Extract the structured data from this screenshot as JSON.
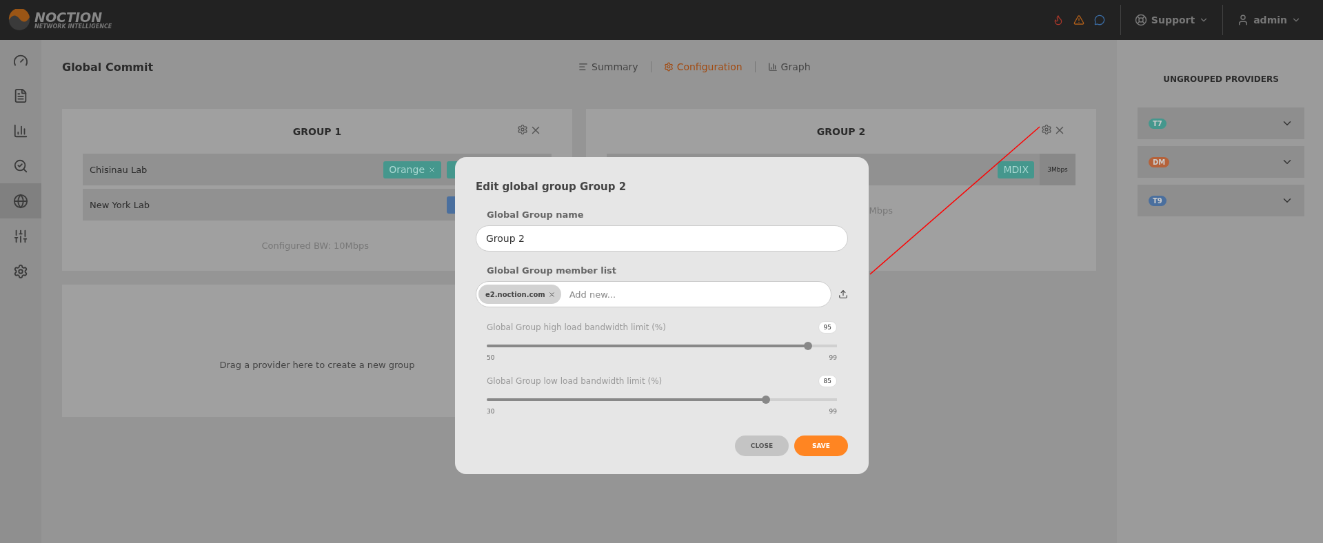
{
  "brand": {
    "name": "NOCTION",
    "tagline": "NETWORK INTELLIGENCE"
  },
  "topbar": {
    "support": "Support",
    "user": "admin"
  },
  "sidebar": {
    "items": [
      {
        "selected": false
      },
      {
        "selected": false
      },
      {
        "selected": false
      },
      {
        "selected": false
      },
      {
        "selected": true
      },
      {
        "selected": false
      },
      {
        "selected": false
      }
    ]
  },
  "page": {
    "title": "Global Commit"
  },
  "tabs": [
    {
      "label": "Summary",
      "selected": false
    },
    {
      "label": "Configuration",
      "selected": true
    },
    {
      "label": "Graph",
      "selected": false
    }
  ],
  "groups": [
    {
      "title": "GROUP 1",
      "rows": [
        {
          "name": "Chisinau Lab",
          "tags": [
            {
              "label": "Orange",
              "color": "#45978d",
              "removable": true
            },
            {
              "color": "#45978d",
              "removable": false
            }
          ]
        },
        {
          "name": "New York Lab",
          "tags": [
            {
              "color": "#4a6f9e",
              "removable": false
            }
          ]
        }
      ],
      "footer": "Configured BW: 10Mbps"
    },
    {
      "title": "GROUP 2",
      "rows": [
        {
          "tags": [
            {
              "label": "MDIX",
              "color": "#45978d",
              "removable": false
            }
          ],
          "bandwidth": "3Mbps"
        }
      ],
      "footer": "Mbps"
    }
  ],
  "dropzone": {
    "text": "Drag a provider here to create a new group"
  },
  "providers": {
    "title": "UNGROUPED PROVIDERS",
    "items": [
      {
        "label": "T7",
        "color": "#45978d"
      },
      {
        "label": "DM",
        "color": "#b5623a"
      },
      {
        "label": "T9",
        "color": "#4a6f9e"
      }
    ]
  },
  "dialog": {
    "title": "Edit global group Group 2",
    "name_label": "Global Group name",
    "name_value": "Group 2",
    "members_label": "Global Group member list",
    "members": [
      "e2.noction.com"
    ],
    "members_placeholder": "Add new...",
    "sliders": [
      {
        "label": "Global Group high load bandwidth limit (%)",
        "value": "95",
        "level": 0.918,
        "min": "50",
        "max": "99"
      },
      {
        "label": "Global Group low load bandwidth limit (%)",
        "value": "85",
        "level": 0.797,
        "min": "30",
        "max": "99"
      }
    ],
    "buttons": [
      {
        "label": "CLOSE",
        "kind": "secondary"
      },
      {
        "label": "SAVE",
        "kind": "primary"
      }
    ]
  }
}
